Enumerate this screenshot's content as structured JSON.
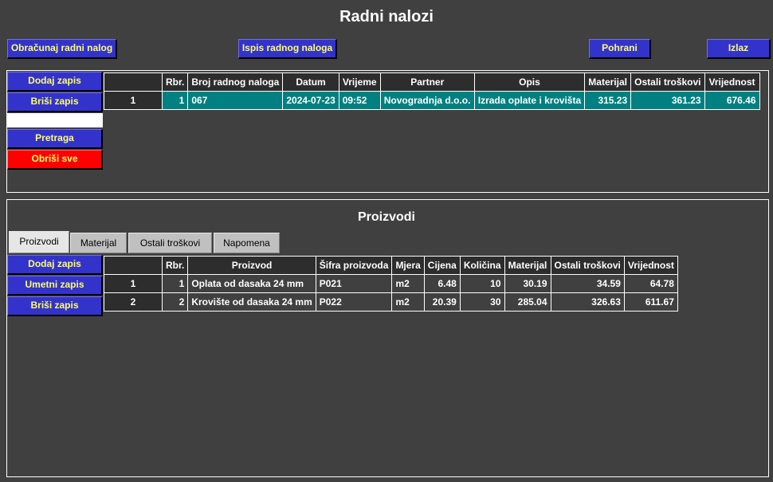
{
  "title": "Radni nalozi",
  "toolbar": {
    "calc": "Obračunaj radni nalog",
    "print": "Ispis radnog naloga",
    "save": "Pohrani",
    "exit": "Izlaz"
  },
  "top_side": {
    "add": "Dodaj zapis",
    "delete": "Briši zapis",
    "search": "Pretraga",
    "clear": "Obriši sve"
  },
  "orders": {
    "headers": [
      "",
      "Rbr.",
      "Broj radnog naloga",
      "Datum",
      "Vrijeme",
      "Partner",
      "Opis",
      "Materijal",
      "Ostali troškovi",
      "Vrijednost"
    ],
    "rows": [
      [
        "1",
        "1",
        "067",
        "2024-07-23",
        "09:52",
        "Novogradnja d.o.o.",
        "Izrada oplate i krovišta",
        "315.23",
        "361.23",
        "676.46"
      ]
    ]
  },
  "products_section": {
    "title": "Proizvodi",
    "tabs": [
      "Proizvodi",
      "Materijal",
      "Ostali troškovi",
      "Napomena"
    ],
    "side": {
      "add": "Dodaj zapis",
      "insert": "Umetni zapis",
      "delete": "Briši zapis"
    },
    "headers": [
      "",
      "Rbr.",
      "Proizvod",
      "Šifra proizvoda",
      "Mjera",
      "Cijena",
      "Količina",
      "Materijal",
      "Ostali troškovi",
      "Vrijednost"
    ],
    "rows": [
      [
        "1",
        "1",
        "Oplata od dasaka 24 mm",
        "P021",
        "m2",
        "6.48",
        "10",
        "30.19",
        "34.59",
        "64.78"
      ],
      [
        "2",
        "2",
        "Krovište od dasaka 24 mm",
        "P022",
        "m2",
        "20.39",
        "30",
        "285.04",
        "326.63",
        "611.67"
      ]
    ]
  }
}
